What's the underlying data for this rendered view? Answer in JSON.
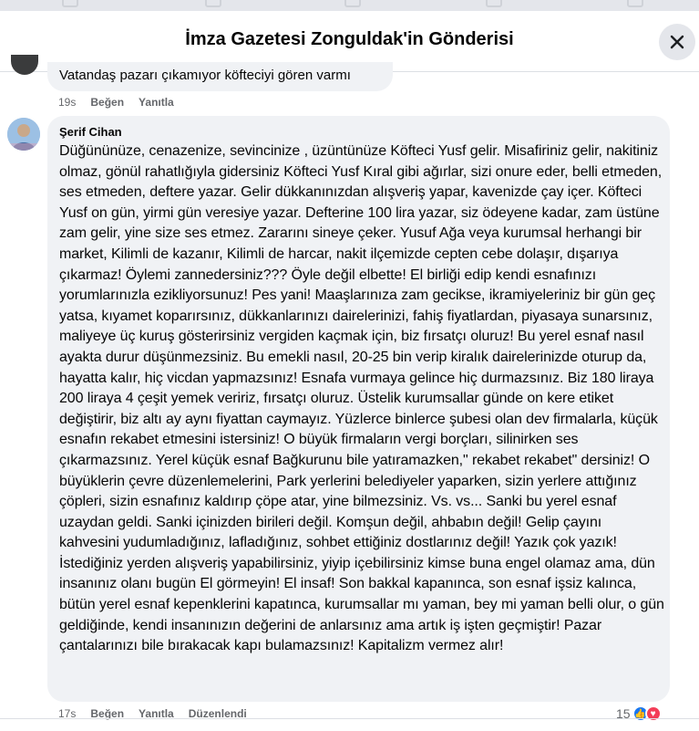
{
  "header": {
    "title": "İmza Gazetesi Zonguldak'in Gönderisi",
    "close_icon": "close-icon"
  },
  "previous_comment": {
    "text": "Vatandaş pazarı çıkamıyor köfteciyi gören varmı",
    "time": "19s",
    "like_label": "Beğen",
    "reply_label": "Yanıtla"
  },
  "comment": {
    "author": "Şerif Cihan",
    "avatar_icon": "avatar",
    "text": "Düğününüze, cenazenize, sevincinize , üzüntünüze Köfteci Yusf gelir. Misafiriniz gelir, nakitiniz olmaz, gönül rahatlığıyla gidersiniz Köfteci Yusf Kıral gibi ağırlar, sizi onure eder, belli etmeden, ses etmeden, deftere yazar. Gelir dükkanınızdan alışveriş yapar, kavenizde çay içer. Köfteci Yusf on gün, yirmi gün veresiye yazar. Defterine 100 lira yazar, siz ödeyene kadar, zam üstüne zam gelir, yine size ses etmez. Zararını sineye çeker. Yusuf Ağa veya kurumsal herhangi bir market, Kilimli de kazanır, Kilimli de harcar, nakit ilçemizde cepten cebe dolaşır, dışarıya çıkarmaz! Öylemi zannedersiniz??? Öyle değil elbette! El birliği edip kendi esnafınızı yorumlarınızla ezikliyorsunuz! Pes yani! Maaşlarınıza zam gecikse, ikramiyeleriniz bir gün geç yatsa, kıyamet koparırsınız, dükkanlarınızı dairelerinizi, fahiş fiyatlardan, piyasaya sunarsınız, maliyeye üç kuruş gösterirsiniz vergiden kaçmak için, biz fırsatçı oluruz! Bu yerel esnaf nasıl ayakta durur düşünmezsiniz. Bu emekli nasıl, 20-25 bin verip kiralık dairelerinizde oturup da, hayatta kalır, hiç vicdan yapmazsınız! Esnafa vurmaya gelince hiç durmazsınız. Biz 180 liraya 200 liraya 4 çeşit yemek veririz, fırsatçı oluruz. Üstelik kurumsallar günde on kere etiket değiştirir, biz altı ay aynı fiyattan caymayız. Yüzlerce binlerce şubesi olan dev firmalarla, küçük esnafın rekabet etmesini istersiniz! O büyük firmaların vergi borçları, silinirken ses çıkarmazsınız. Yerel küçük esnaf Bağkurunu bile yatıramazken,\" rekabet rekabet\" dersiniz! O büyüklerin çevre düzenlemelerini, Park yerlerini belediyeler yaparken, sizin yerlere attığınız çöpleri, sizin esnafınız kaldırıp çöpe atar, yine bilmezsiniz. Vs. vs... Sanki bu yerel esnaf uzaydan geldi. Sanki içinizden birileri değil. Komşun değil, ahbabın değil! Gelip çayını kahvesini yudumladığınız, lafladığınız, sohbet ettiğiniz dostlarınız değil! Yazık çok yazık! İstediğiniz yerden alışveriş yapabilirsiniz, yiyip içebilirsiniz kimse buna engel olamaz ama, dün insanınız olanı bugün El görmeyin! El insaf! Son bakkal kapanınca, son esnaf işsiz kalınca, bütün yerel esnaf kepenklerini kapatınca, kurumsallar mı yaman, bey mi yaman belli olur, o gün geldiğinde, kendi insanınızın değerini de anlarsınız ama artık iş işten geçmiştir! Pazar çantalarınızı bile bırakacak kapı bulamazsınız! Kapitalizm vermez alır!",
    "time": "17s",
    "like_label": "Beğen",
    "reply_label": "Yanıtla",
    "edited_label": "Düzenlendi",
    "reaction_count": "15",
    "reaction_icons": [
      "like-reaction-icon",
      "love-reaction-icon"
    ],
    "colors": {
      "like": "#1877f2",
      "love": "#f33e58"
    }
  }
}
